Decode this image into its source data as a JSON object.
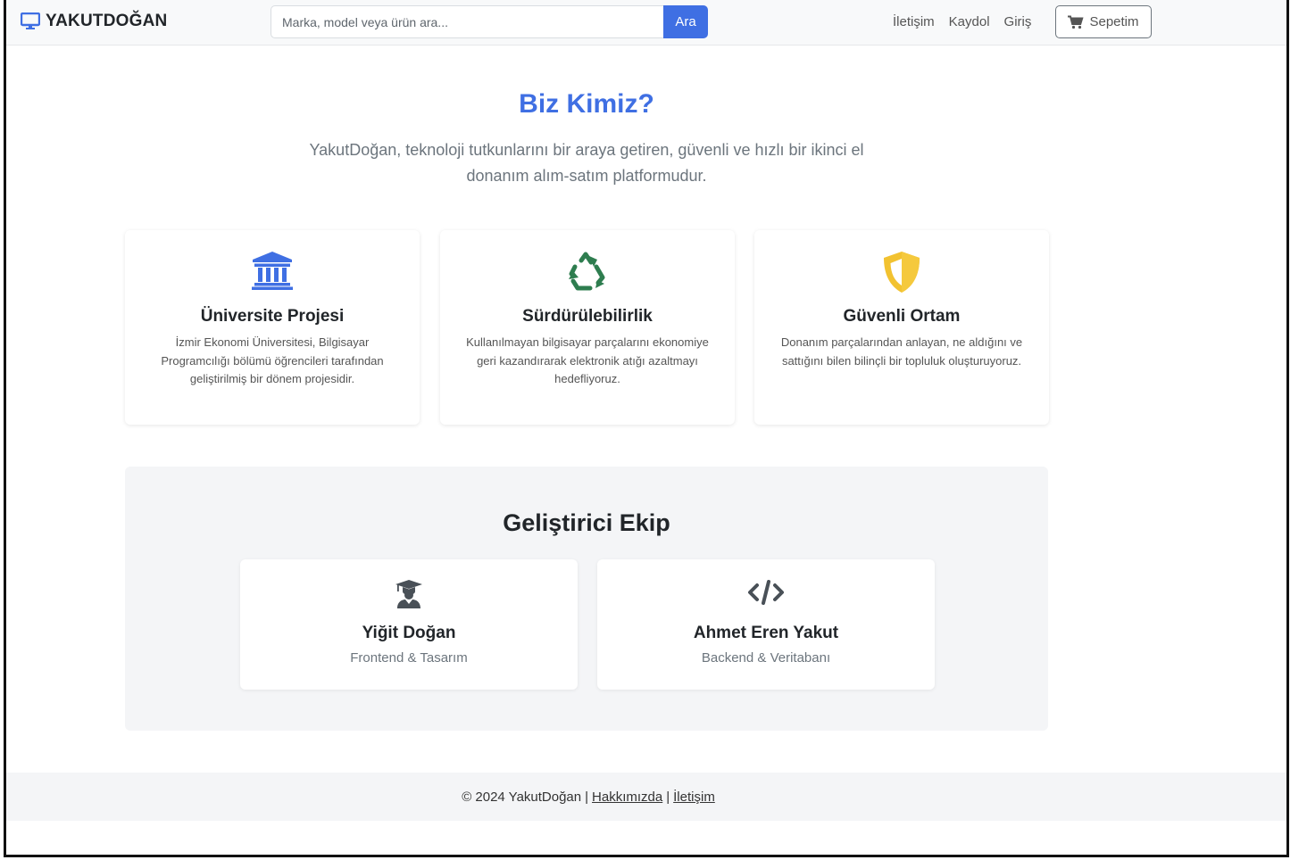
{
  "navbar": {
    "brand": "YAKUTDOĞAN",
    "search_placeholder": "Marka, model veya ürün ara...",
    "search_button": "Ara",
    "links": [
      "İletişim",
      "Kaydol",
      "Giriş"
    ],
    "cart_label": "Sepetim"
  },
  "hero": {
    "title": "Biz Kimiz?",
    "subtitle": "YakutDoğan, teknoloji tutkunlarını bir araya getiren, güvenli ve hızlı bir ikinci el donanım alım-satım platformudur."
  },
  "features": [
    {
      "icon": "university-icon",
      "title": "Üniversite Projesi",
      "text": "İzmir Ekonomi Üniversitesi, Bilgisayar Programcılığı bölümü öğrencileri tarafından geliştirilmiş bir dönem projesidir."
    },
    {
      "icon": "recycle-icon",
      "title": "Sürdürülebilirlik",
      "text": "Kullanılmayan bilgisayar parçalarını ekonomiye geri kazandırarak elektronik atığı azaltmayı hedefliyoruz."
    },
    {
      "icon": "shield-icon",
      "title": "Güvenli Ortam",
      "text": "Donanım parçalarından anlayan, ne aldığını ve sattığını bilen bilinçli bir topluluk oluşturuyoruz."
    }
  ],
  "team": {
    "title": "Geliştirici Ekip",
    "members": [
      {
        "icon": "graduate-icon",
        "name": "Yiğit Doğan",
        "role": "Frontend & Tasarım"
      },
      {
        "icon": "code-icon",
        "name": "Ahmet Eren Yakut",
        "role": "Backend & Veritabanı"
      }
    ]
  },
  "footer": {
    "copyright": "© 2024 YakutDoğan",
    "separator": "|",
    "links": [
      "Hakkımızda",
      "İletişim"
    ]
  },
  "colors": {
    "primary": "#3f6fe3",
    "recycle": "#2e7d4f",
    "shield": "#f2c230"
  }
}
